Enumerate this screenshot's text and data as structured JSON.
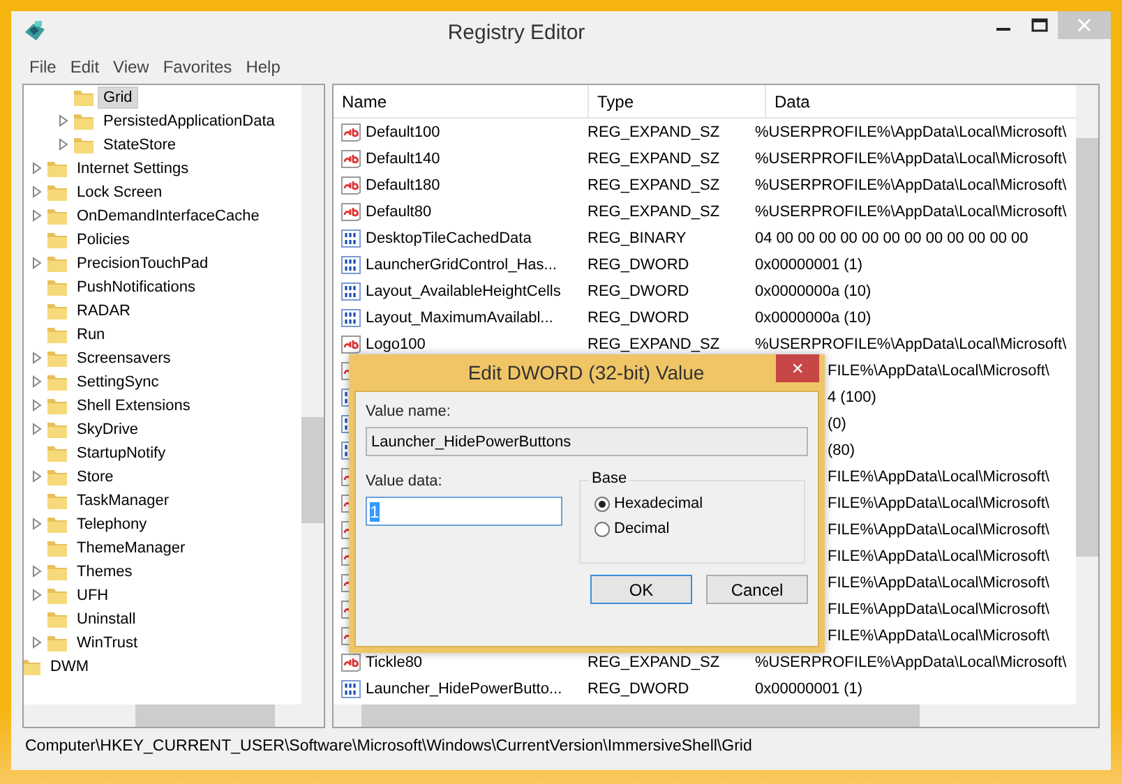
{
  "window": {
    "title": "Registry Editor"
  },
  "menu": [
    "File",
    "Edit",
    "View",
    "Favorites",
    "Help"
  ],
  "tree": [
    {
      "children": [
        {
          "children": [
            {
              "label": "Grid",
              "expandable": false,
              "selected": true
            },
            {
              "label": "PersistedApplicationData",
              "expandable": true,
              "selected": false
            },
            {
              "label": "StateStore",
              "expandable": true,
              "selected": false
            }
          ]
        },
        {
          "label": "Internet Settings",
          "expandable": true,
          "selected": false
        },
        {
          "label": "Lock Screen",
          "expandable": true,
          "selected": false
        },
        {
          "label": "OnDemandInterfaceCache",
          "expandable": true,
          "selected": false
        },
        {
          "label": "Policies",
          "expandable": false,
          "selected": false
        },
        {
          "label": "PrecisionTouchPad",
          "expandable": true,
          "selected": false
        },
        {
          "label": "PushNotifications",
          "expandable": false,
          "selected": false
        },
        {
          "label": "RADAR",
          "expandable": false,
          "selected": false
        },
        {
          "label": "Run",
          "expandable": false,
          "selected": false
        },
        {
          "label": "Screensavers",
          "expandable": true,
          "selected": false
        },
        {
          "label": "SettingSync",
          "expandable": true,
          "selected": false
        },
        {
          "label": "Shell Extensions",
          "expandable": true,
          "selected": false
        },
        {
          "label": "SkyDrive",
          "expandable": true,
          "selected": false
        },
        {
          "label": "StartupNotify",
          "expandable": false,
          "selected": false
        },
        {
          "label": "Store",
          "expandable": true,
          "selected": false
        },
        {
          "label": "TaskManager",
          "expandable": false,
          "selected": false
        },
        {
          "label": "Telephony",
          "expandable": true,
          "selected": false
        },
        {
          "label": "ThemeManager",
          "expandable": false,
          "selected": false
        },
        {
          "label": "Themes",
          "expandable": true,
          "selected": false
        },
        {
          "label": "UFH",
          "expandable": true,
          "selected": false
        },
        {
          "label": "Uninstall",
          "expandable": false,
          "selected": false
        },
        {
          "label": "WinTrust",
          "expandable": true,
          "selected": false
        }
      ]
    },
    {
      "label": "DWM",
      "selected": false
    }
  ],
  "table": {
    "columns": [
      "Name",
      "Type",
      "Data"
    ],
    "rows": [
      {
        "kind": "string",
        "name": "Default100",
        "type": "REG_EXPAND_SZ",
        "data": "%USERPROFILE%\\AppData\\Local\\Microsoft\\"
      },
      {
        "kind": "string",
        "name": "Default140",
        "type": "REG_EXPAND_SZ",
        "data": "%USERPROFILE%\\AppData\\Local\\Microsoft\\"
      },
      {
        "kind": "string",
        "name": "Default180",
        "type": "REG_EXPAND_SZ",
        "data": "%USERPROFILE%\\AppData\\Local\\Microsoft\\"
      },
      {
        "kind": "string",
        "name": "Default80",
        "type": "REG_EXPAND_SZ",
        "data": "%USERPROFILE%\\AppData\\Local\\Microsoft\\"
      },
      {
        "kind": "binary",
        "name": "DesktopTileCachedData",
        "type": "REG_BINARY",
        "data": "04 00 00 00 00 00 00 00 00 00 00 00 00"
      },
      {
        "kind": "binary",
        "name": "LauncherGridControl_Has...",
        "type": "REG_DWORD",
        "data": "0x00000001 (1)"
      },
      {
        "kind": "binary",
        "name": "Layout_AvailableHeightCells",
        "type": "REG_DWORD",
        "data": "0x0000000a (10)"
      },
      {
        "kind": "binary",
        "name": "Layout_MaximumAvailabl...",
        "type": "REG_DWORD",
        "data": "0x0000000a (10)"
      },
      {
        "kind": "string",
        "name": "Logo100",
        "type": "REG_EXPAND_SZ",
        "data": "%USERPROFILE%\\AppData\\Local\\Microsoft\\"
      },
      {
        "kind": "string",
        "data": "FILE%\\AppData\\Local\\Microsoft\\"
      },
      {
        "kind": "binary",
        "data": "4 (100)"
      },
      {
        "kind": "binary",
        "data": "(0)"
      },
      {
        "kind": "binary",
        "data": "(80)"
      },
      {
        "kind": "string",
        "data": "FILE%\\AppData\\Local\\Microsoft\\"
      },
      {
        "kind": "string",
        "data": "FILE%\\AppData\\Local\\Microsoft\\"
      },
      {
        "kind": "string",
        "data": "FILE%\\AppData\\Local\\Microsoft\\"
      },
      {
        "kind": "string",
        "data": "FILE%\\AppData\\Local\\Microsoft\\"
      },
      {
        "kind": "string",
        "data": "FILE%\\AppData\\Local\\Microsoft\\"
      },
      {
        "kind": "string",
        "data": "FILE%\\AppData\\Local\\Microsoft\\"
      },
      {
        "kind": "string",
        "data": "FILE%\\AppData\\Local\\Microsoft\\"
      },
      {
        "kind": "string",
        "name": "Tickle80",
        "type": "REG_EXPAND_SZ",
        "data": "%USERPROFILE%\\AppData\\Local\\Microsoft\\"
      },
      {
        "kind": "binary",
        "name": "Launcher_HidePowerButto...",
        "type": "REG_DWORD",
        "data": "0x00000001 (1)"
      }
    ]
  },
  "dialog": {
    "title": "Edit DWORD (32-bit) Value",
    "close": "✕",
    "value_name_label": "Value name:",
    "value_name": "Launcher_HidePowerButtons",
    "value_data_label": "Value data:",
    "value_data": "1",
    "base_label": "Base",
    "bases": [
      {
        "label": "Hexadecimal",
        "selected": true
      },
      {
        "label": "Decimal",
        "selected": false
      }
    ],
    "buttons": [
      {
        "label": "OK",
        "focused": true
      },
      {
        "label": "Cancel",
        "focused": false
      }
    ]
  },
  "status_bar": "Computer\\HKEY_CURRENT_USER\\Software\\Microsoft\\Windows\\CurrentVersion\\ImmersiveShell\\Grid"
}
